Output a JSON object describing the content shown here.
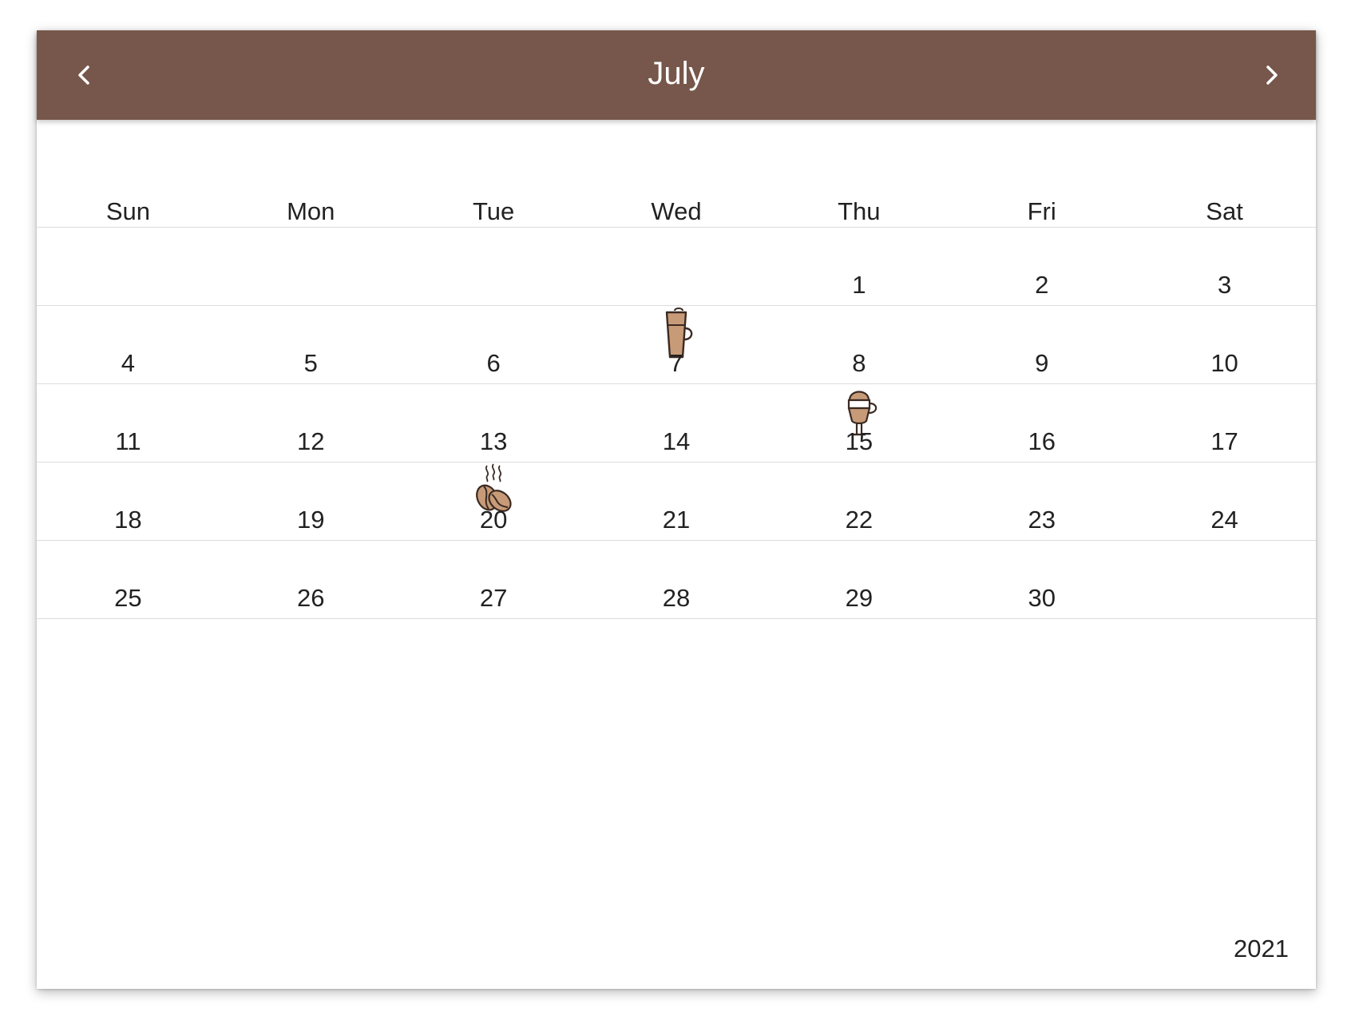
{
  "header": {
    "title": "July",
    "prev_icon": "chevron-left-icon",
    "next_icon": "chevron-right-icon",
    "background_color": "#77574b"
  },
  "weekdays": [
    "Sun",
    "Mon",
    "Tue",
    "Wed",
    "Thu",
    "Fri",
    "Sat"
  ],
  "weeks": [
    [
      "",
      "",
      "",
      "",
      "1",
      "2",
      "3"
    ],
    [
      "4",
      "5",
      "6",
      "7",
      "8",
      "9",
      "10"
    ],
    [
      "11",
      "12",
      "13",
      "14",
      "15",
      "16",
      "17"
    ],
    [
      "18",
      "19",
      "20",
      "21",
      "22",
      "23",
      "24"
    ],
    [
      "25",
      "26",
      "27",
      "28",
      "29",
      "30",
      ""
    ]
  ],
  "markers": [
    {
      "day": "7",
      "icon": "latte-glass-icon"
    },
    {
      "day": "15",
      "icon": "irish-coffee-icon"
    },
    {
      "day": "20",
      "icon": "coffee-beans-icon"
    }
  ],
  "footer": {
    "year": "2021"
  },
  "colors": {
    "icon_fill": "#c89b78",
    "icon_stroke": "#3a2a22"
  }
}
